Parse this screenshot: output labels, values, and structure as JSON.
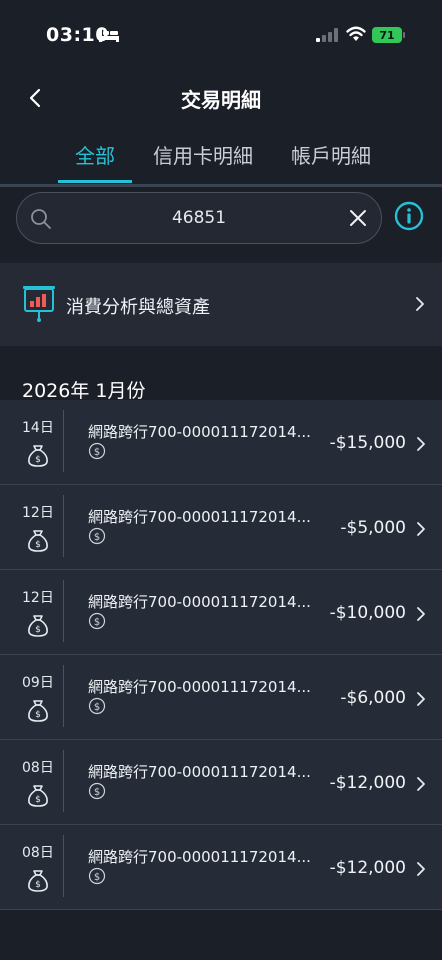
{
  "status_bar": {
    "time": "03:10",
    "battery": "71"
  },
  "nav": {
    "title": "交易明細"
  },
  "tabs": [
    {
      "label": "全部"
    },
    {
      "label": "信用卡明細"
    },
    {
      "label": "帳戶明細"
    }
  ],
  "search": {
    "value": "46851"
  },
  "analysis": {
    "label": "消費分析與總資產"
  },
  "month_header": "2026年 1月份",
  "transactions": [
    {
      "date": "14日",
      "description": "網路跨行700-000011172014...",
      "amount": "-$15,000"
    },
    {
      "date": "12日",
      "description": "網路跨行700-000011172014...",
      "amount": "-$5,000"
    },
    {
      "date": "12日",
      "description": "網路跨行700-000011172014...",
      "amount": "-$10,000"
    },
    {
      "date": "09日",
      "description": "網路跨行700-000011172014...",
      "amount": "-$6,000"
    },
    {
      "date": "08日",
      "description": "網路跨行700-000011172014...",
      "amount": "-$12,000"
    },
    {
      "date": "08日",
      "description": "網路跨行700-000011172014...",
      "amount": "-$12,000"
    }
  ],
  "colors": {
    "accent": "#27c1d6",
    "background": "#1b1f28",
    "card": "#262c37",
    "battery": "#33c759"
  }
}
